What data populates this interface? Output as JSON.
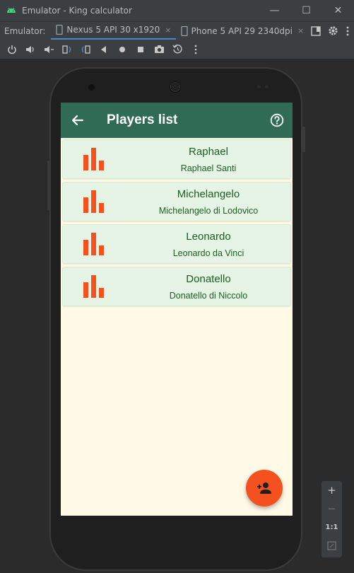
{
  "window": {
    "title": "Emulator - King calculator",
    "minimize": "—",
    "maximize": "☐",
    "close": "✕"
  },
  "tabs": {
    "label": "Emulator:",
    "items": [
      {
        "label": "Nexus 5 API 30 x1920",
        "close": "×"
      },
      {
        "label": "Phone 5 API 29 2340dpi",
        "close": "×"
      }
    ]
  },
  "app": {
    "title": "Players list",
    "colors": {
      "appbar": "#2f6b55",
      "background": "#fff9e6",
      "card": "#e6f4e6",
      "text": "#1b5e20",
      "accent": "#f4511e"
    },
    "players": [
      {
        "name": "Raphael",
        "full_name": "Raphael Santi"
      },
      {
        "name": "Michelangelo",
        "full_name": "Michelangelo di Lodovico"
      },
      {
        "name": "Leonardo",
        "full_name": "Leonardo da Vinci"
      },
      {
        "name": "Donatello",
        "full_name": "Donatello di Niccolo"
      }
    ]
  },
  "zoom": {
    "zoom_in": "+",
    "zoom_out": "−",
    "actual_size": "1:1"
  }
}
